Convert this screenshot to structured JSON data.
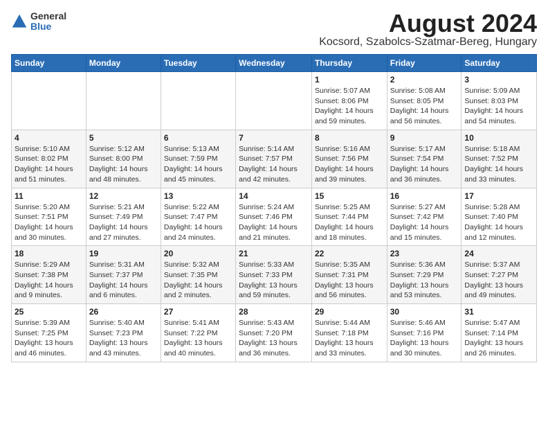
{
  "logo": {
    "general": "General",
    "blue": "Blue"
  },
  "title": "August 2024",
  "subtitle": "Kocsord, Szabolcs-Szatmar-Bereg, Hungary",
  "weekdays": [
    "Sunday",
    "Monday",
    "Tuesday",
    "Wednesday",
    "Thursday",
    "Friday",
    "Saturday"
  ],
  "weeks": [
    [
      {
        "day": "",
        "info": ""
      },
      {
        "day": "",
        "info": ""
      },
      {
        "day": "",
        "info": ""
      },
      {
        "day": "",
        "info": ""
      },
      {
        "day": "1",
        "info": "Sunrise: 5:07 AM\nSunset: 8:06 PM\nDaylight: 14 hours\nand 59 minutes."
      },
      {
        "day": "2",
        "info": "Sunrise: 5:08 AM\nSunset: 8:05 PM\nDaylight: 14 hours\nand 56 minutes."
      },
      {
        "day": "3",
        "info": "Sunrise: 5:09 AM\nSunset: 8:03 PM\nDaylight: 14 hours\nand 54 minutes."
      }
    ],
    [
      {
        "day": "4",
        "info": "Sunrise: 5:10 AM\nSunset: 8:02 PM\nDaylight: 14 hours\nand 51 minutes."
      },
      {
        "day": "5",
        "info": "Sunrise: 5:12 AM\nSunset: 8:00 PM\nDaylight: 14 hours\nand 48 minutes."
      },
      {
        "day": "6",
        "info": "Sunrise: 5:13 AM\nSunset: 7:59 PM\nDaylight: 14 hours\nand 45 minutes."
      },
      {
        "day": "7",
        "info": "Sunrise: 5:14 AM\nSunset: 7:57 PM\nDaylight: 14 hours\nand 42 minutes."
      },
      {
        "day": "8",
        "info": "Sunrise: 5:16 AM\nSunset: 7:56 PM\nDaylight: 14 hours\nand 39 minutes."
      },
      {
        "day": "9",
        "info": "Sunrise: 5:17 AM\nSunset: 7:54 PM\nDaylight: 14 hours\nand 36 minutes."
      },
      {
        "day": "10",
        "info": "Sunrise: 5:18 AM\nSunset: 7:52 PM\nDaylight: 14 hours\nand 33 minutes."
      }
    ],
    [
      {
        "day": "11",
        "info": "Sunrise: 5:20 AM\nSunset: 7:51 PM\nDaylight: 14 hours\nand 30 minutes."
      },
      {
        "day": "12",
        "info": "Sunrise: 5:21 AM\nSunset: 7:49 PM\nDaylight: 14 hours\nand 27 minutes."
      },
      {
        "day": "13",
        "info": "Sunrise: 5:22 AM\nSunset: 7:47 PM\nDaylight: 14 hours\nand 24 minutes."
      },
      {
        "day": "14",
        "info": "Sunrise: 5:24 AM\nSunset: 7:46 PM\nDaylight: 14 hours\nand 21 minutes."
      },
      {
        "day": "15",
        "info": "Sunrise: 5:25 AM\nSunset: 7:44 PM\nDaylight: 14 hours\nand 18 minutes."
      },
      {
        "day": "16",
        "info": "Sunrise: 5:27 AM\nSunset: 7:42 PM\nDaylight: 14 hours\nand 15 minutes."
      },
      {
        "day": "17",
        "info": "Sunrise: 5:28 AM\nSunset: 7:40 PM\nDaylight: 14 hours\nand 12 minutes."
      }
    ],
    [
      {
        "day": "18",
        "info": "Sunrise: 5:29 AM\nSunset: 7:38 PM\nDaylight: 14 hours\nand 9 minutes."
      },
      {
        "day": "19",
        "info": "Sunrise: 5:31 AM\nSunset: 7:37 PM\nDaylight: 14 hours\nand 6 minutes."
      },
      {
        "day": "20",
        "info": "Sunrise: 5:32 AM\nSunset: 7:35 PM\nDaylight: 14 hours\nand 2 minutes."
      },
      {
        "day": "21",
        "info": "Sunrise: 5:33 AM\nSunset: 7:33 PM\nDaylight: 13 hours\nand 59 minutes."
      },
      {
        "day": "22",
        "info": "Sunrise: 5:35 AM\nSunset: 7:31 PM\nDaylight: 13 hours\nand 56 minutes."
      },
      {
        "day": "23",
        "info": "Sunrise: 5:36 AM\nSunset: 7:29 PM\nDaylight: 13 hours\nand 53 minutes."
      },
      {
        "day": "24",
        "info": "Sunrise: 5:37 AM\nSunset: 7:27 PM\nDaylight: 13 hours\nand 49 minutes."
      }
    ],
    [
      {
        "day": "25",
        "info": "Sunrise: 5:39 AM\nSunset: 7:25 PM\nDaylight: 13 hours\nand 46 minutes."
      },
      {
        "day": "26",
        "info": "Sunrise: 5:40 AM\nSunset: 7:23 PM\nDaylight: 13 hours\nand 43 minutes."
      },
      {
        "day": "27",
        "info": "Sunrise: 5:41 AM\nSunset: 7:22 PM\nDaylight: 13 hours\nand 40 minutes."
      },
      {
        "day": "28",
        "info": "Sunrise: 5:43 AM\nSunset: 7:20 PM\nDaylight: 13 hours\nand 36 minutes."
      },
      {
        "day": "29",
        "info": "Sunrise: 5:44 AM\nSunset: 7:18 PM\nDaylight: 13 hours\nand 33 minutes."
      },
      {
        "day": "30",
        "info": "Sunrise: 5:46 AM\nSunset: 7:16 PM\nDaylight: 13 hours\nand 30 minutes."
      },
      {
        "day": "31",
        "info": "Sunrise: 5:47 AM\nSunset: 7:14 PM\nDaylight: 13 hours\nand 26 minutes."
      }
    ]
  ]
}
